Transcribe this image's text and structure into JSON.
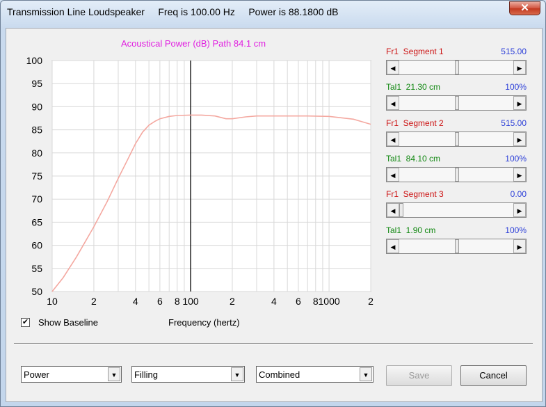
{
  "window": {
    "title": "Transmission Line Loudspeaker     Freq is 100.00 Hz     Power is 88.1800 dB",
    "close_glyph": "✕"
  },
  "chart": {
    "title": "Acoustical Power (dB)   Path 84.1 cm"
  },
  "segments": [
    {
      "label": "Fr1  Segment 1",
      "value": "515.00",
      "color": "#cc1111",
      "thumb_fraction": 0.5
    },
    {
      "label": "Tal1  21.30 cm",
      "value": "100%",
      "color": "#118811",
      "thumb_fraction": 0.5
    },
    {
      "label": "Fr1  Segment 2",
      "value": "515.00",
      "color": "#cc1111",
      "thumb_fraction": 0.5
    },
    {
      "label": "Tal1  84.10 cm",
      "value": "100%",
      "color": "#118811",
      "thumb_fraction": 0.5
    },
    {
      "label": "Fr1  Segment 3",
      "value": "0.00",
      "color": "#cc1111",
      "thumb_fraction": 0.0
    },
    {
      "label": "Tal1  1.90 cm",
      "value": "100%",
      "color": "#118811",
      "thumb_fraction": 0.5
    }
  ],
  "options": {
    "show_baseline_label": "Show Baseline",
    "show_baseline_checked": true,
    "frequency_label": "Frequency (hertz)"
  },
  "controls": {
    "dropdown1": "Power",
    "dropdown2": "Filling",
    "dropdown3": "Combined",
    "save_label": "Save",
    "cancel_label": "Cancel"
  },
  "chart_data": {
    "type": "line",
    "title": "Acoustical Power (dB)   Path 84.1 cm",
    "xlabel": "Frequency (hertz)",
    "ylabel": "",
    "x_scale": "log",
    "xlim": [
      10,
      2000
    ],
    "ylim": [
      50,
      100
    ],
    "yticks": [
      50,
      55,
      60,
      65,
      70,
      75,
      80,
      85,
      90,
      95,
      100
    ],
    "xtick_labels": [
      {
        "value": 10,
        "label": "10"
      },
      {
        "value": 20,
        "label": "2"
      },
      {
        "value": 40,
        "label": "4"
      },
      {
        "value": 60,
        "label": "6"
      },
      {
        "value": 80,
        "label": "8"
      },
      {
        "value": 100,
        "label": "100"
      },
      {
        "value": 200,
        "label": "2"
      },
      {
        "value": 400,
        "label": "4"
      },
      {
        "value": 600,
        "label": "6"
      },
      {
        "value": 800,
        "label": "8"
      },
      {
        "value": 1000,
        "label": "1000"
      },
      {
        "value": 2000,
        "label": "2"
      }
    ],
    "grid": true,
    "cursor_x": 100,
    "series": [
      {
        "color": "#f4a8a0",
        "x": [
          10,
          12,
          15,
          20,
          25,
          30,
          35,
          40,
          45,
          50,
          55,
          60,
          70,
          80,
          100,
          120,
          150,
          180,
          200,
          250,
          300,
          400,
          500,
          700,
          1000,
          1500,
          2000
        ],
        "y": [
          50,
          53,
          57.5,
          64,
          69.5,
          74.5,
          78.5,
          82,
          84.5,
          86,
          86.8,
          87.4,
          87.9,
          88.1,
          88.2,
          88.2,
          88,
          87.4,
          87.4,
          87.8,
          88,
          88,
          88,
          88,
          87.9,
          87.3,
          86.2
        ]
      }
    ]
  }
}
